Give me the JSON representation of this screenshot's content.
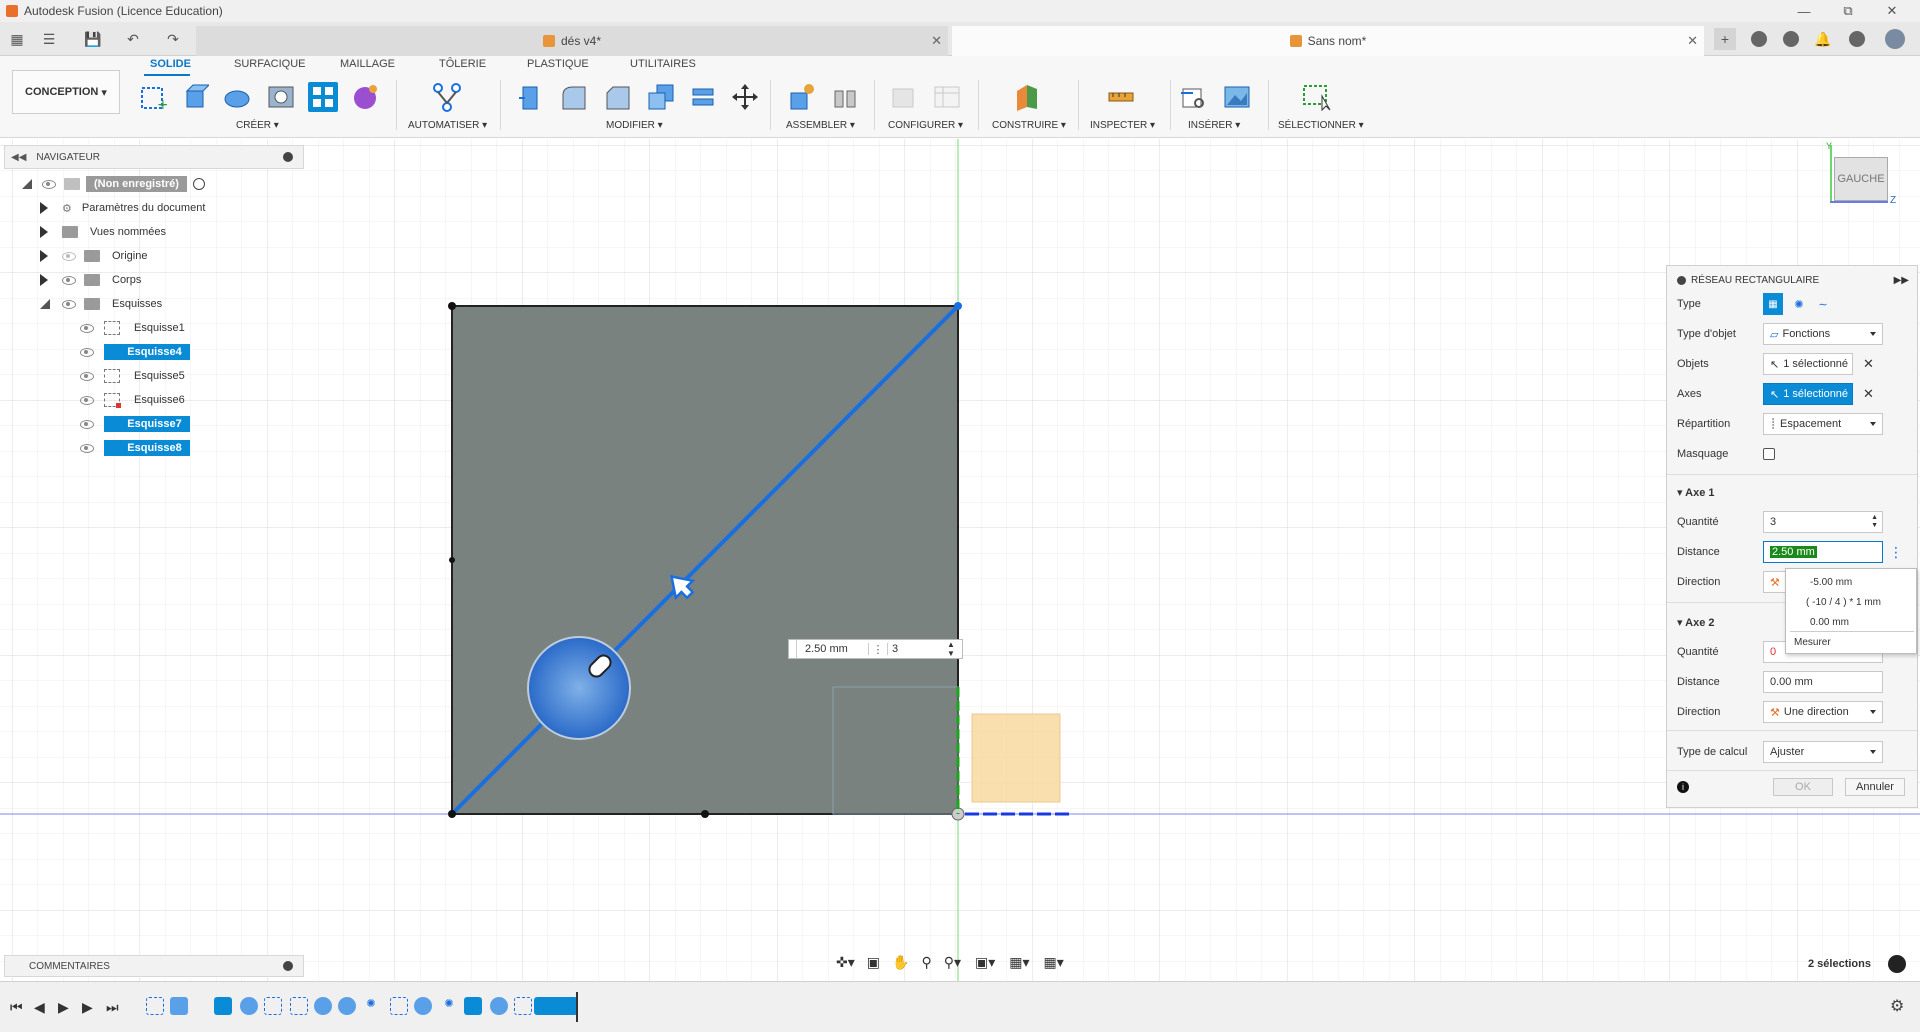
{
  "window": {
    "title": "Autodesk Fusion (Licence Education)"
  },
  "tabs": [
    {
      "label": "dés v4*"
    },
    {
      "label": "Sans nom*"
    }
  ],
  "ribbon": {
    "workspace": "CONCEPTION",
    "tabs": [
      "SOLIDE",
      "SURFACIQUE",
      "MAILLAGE",
      "TÔLERIE",
      "PLASTIQUE",
      "UTILITAIRES"
    ],
    "groups": [
      "CRÉER",
      "AUTOMATISER",
      "MODIFIER",
      "ASSEMBLER",
      "CONFIGURER",
      "CONSTRUIRE",
      "INSPECTER",
      "INSÉRER",
      "SÉLECTIONNER"
    ]
  },
  "navigator": {
    "title": "NAVIGATEUR",
    "root": "(Non enregistré)",
    "items": [
      "Paramètres du document",
      "Vues nommées",
      "Origine",
      "Corps",
      "Esquisses"
    ],
    "sketches": [
      "Esquisse1",
      "Esquisse4",
      "Esquisse5",
      "Esquisse6",
      "Esquisse7",
      "Esquisse8"
    ]
  },
  "comments": {
    "title": "COMMENTAIRES"
  },
  "viewcube": {
    "label": "GAUCHE",
    "axis_z": "Z",
    "axis_y": "Y"
  },
  "canvas_inputs": {
    "distance": "2.50 mm",
    "quantity": "3"
  },
  "panel": {
    "title": "RÉSEAU RECTANGULAIRE",
    "type_label": "Type",
    "object_type_label": "Type d'objet",
    "object_type_value": "Fonctions",
    "objects_label": "Objets",
    "objects_value": "1 sélectionné",
    "axes_label": "Axes",
    "axes_value": "1 sélectionné",
    "distribution_label": "Répartition",
    "distribution_value": "Espacement",
    "suppression_label": "Masquage",
    "axis1": {
      "title": "Axe 1",
      "quantity_label": "Quantité",
      "quantity_value": "3",
      "distance_label": "Distance",
      "distance_value": "2.50 mm",
      "direction_label": "Direction"
    },
    "axis2": {
      "title": "Axe 2",
      "quantity_label": "Quantité",
      "quantity_value": "0",
      "distance_label": "Distance",
      "distance_value": "0.00 mm",
      "direction_label": "Direction",
      "direction_value": "Une direction"
    },
    "calc_label": "Type de calcul",
    "calc_value": "Ajuster",
    "ok": "OK",
    "cancel": "Annuler"
  },
  "dropdown": {
    "items": [
      "-5.00 mm",
      "( -10 / 4 ) * 1 mm",
      "0.00 mm"
    ],
    "measure": "Mesurer"
  },
  "status": {
    "selections": "2 sélections"
  },
  "colors": {
    "accent": "#0a8bd6",
    "body": "#7a8280",
    "line": "#1a6fe0"
  }
}
